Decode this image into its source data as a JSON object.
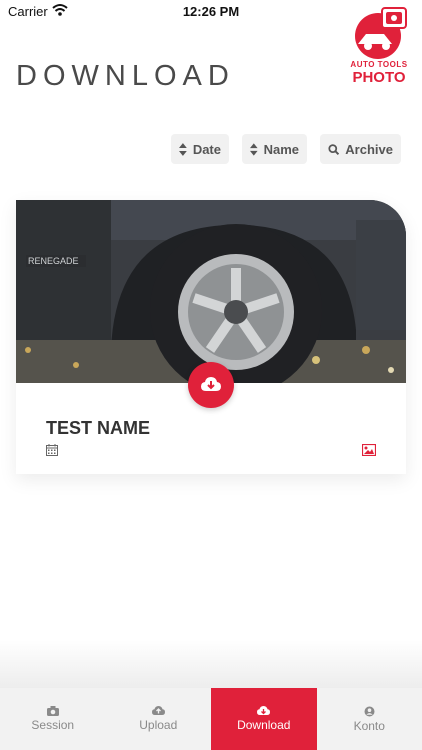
{
  "status_bar": {
    "carrier": "Carrier",
    "time": "12:26 PM"
  },
  "header": {
    "title": "DOWNLOAD",
    "logo_line1": "AUTO TOOLS",
    "logo_line2": "PHOTO"
  },
  "sort_buttons": {
    "date": "Date",
    "name": "Name",
    "archive": "Archive"
  },
  "card": {
    "title": "TEST NAME",
    "photo_text": "RENEGADE"
  },
  "tabs": [
    {
      "label": "Session",
      "icon": "camera-icon"
    },
    {
      "label": "Upload",
      "icon": "cloud-upload-icon"
    },
    {
      "label": "Download",
      "icon": "cloud-download-icon"
    },
    {
      "label": "Konto",
      "icon": "user-icon"
    }
  ],
  "colors": {
    "accent": "#e0213a",
    "tab_bg": "#f2f2f2"
  }
}
